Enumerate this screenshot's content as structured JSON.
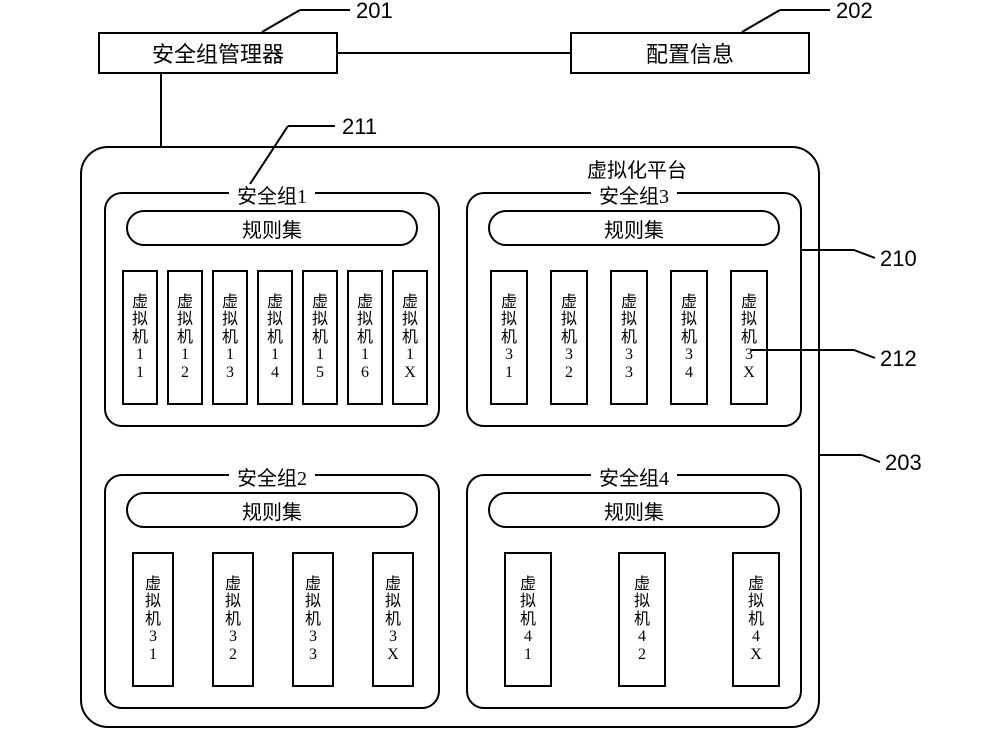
{
  "header": {
    "manager_label": "安全组管理器",
    "config_label": "配置信息",
    "num_manager": "201",
    "num_config": "202"
  },
  "platform": {
    "label": "虚拟化平台",
    "num": "203",
    "num_group": "210",
    "num_sg1": "211",
    "num_vm": "212"
  },
  "ruleset_label": "规则集",
  "groups": {
    "g1": {
      "title": "安全组1",
      "vms": [
        "虚拟机11",
        "虚拟机12",
        "虚拟机13",
        "虚拟机14",
        "虚拟机15",
        "虚拟机16",
        "虚拟机1X"
      ]
    },
    "g2": {
      "title": "安全组2",
      "vms": [
        "虚拟机31",
        "虚拟机32",
        "虚拟机33",
        "虚拟机3X"
      ]
    },
    "g3": {
      "title": "安全组3",
      "vms": [
        "虚拟机31",
        "虚拟机32",
        "虚拟机33",
        "虚拟机34",
        "虚拟机3X"
      ]
    },
    "g4": {
      "title": "安全组4",
      "vms": [
        "虚拟机41",
        "虚拟机42",
        "虚拟机4X"
      ]
    }
  }
}
